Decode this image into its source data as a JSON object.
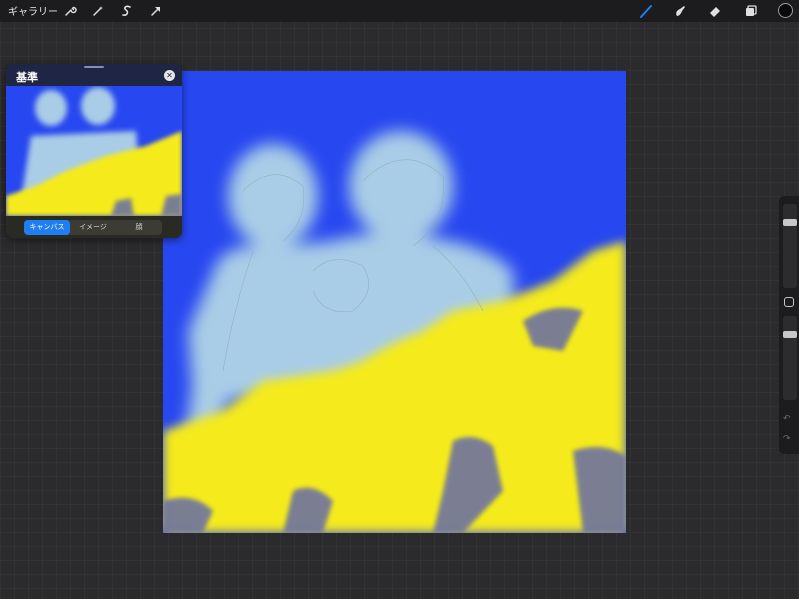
{
  "toolbar": {
    "gallery_label": "ギャラリー",
    "left_tools": [
      "wrench-icon",
      "magic-wand-icon",
      "selection-icon",
      "transform-arrow-icon"
    ],
    "right_tools": [
      "brush-icon",
      "smudge-icon",
      "eraser-icon",
      "layers-icon"
    ],
    "active_tool": "brush-icon",
    "accent_color": "#1f7ff2",
    "current_color": "#0a0a0a"
  },
  "reference_window": {
    "title": "基準",
    "tabs": [
      {
        "label": "キャンバス",
        "active": true
      },
      {
        "label": "イメージ",
        "active": false
      },
      {
        "label": "顔",
        "active": false
      }
    ]
  },
  "canvas": {
    "colors": {
      "background": "#2747f0",
      "paint_yellow": "#f4ea1e",
      "figure_light_blue": "#a9cde6"
    }
  },
  "sidebar": {
    "brush_size_level": 0.2,
    "opacity_level": 0.2
  }
}
